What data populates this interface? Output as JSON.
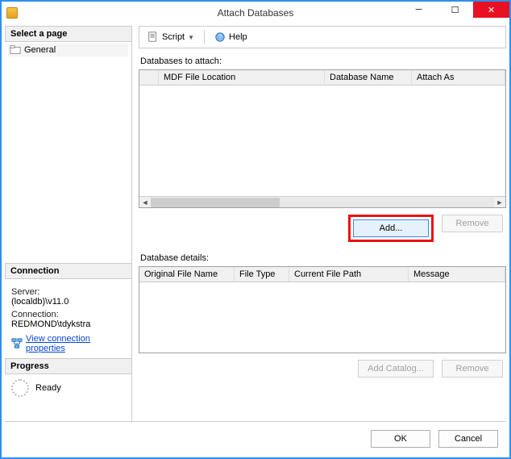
{
  "window": {
    "title": "Attach Databases",
    "minimize_glyph": "─",
    "maximize_glyph": "☐",
    "close_glyph": "✕"
  },
  "left": {
    "select_page_header": "Select a page",
    "pages": {
      "general": "General"
    },
    "connection_header": "Connection",
    "server_label": "Server:",
    "server_value": "(localdb)\\v11.0",
    "connection_label": "Connection:",
    "connection_value": "REDMOND\\tdykstra",
    "view_conn_props": "View connection properties",
    "progress_header": "Progress",
    "progress_label": "Ready"
  },
  "toolbar": {
    "script_label": "Script",
    "help_label": "Help"
  },
  "attach": {
    "label": "Databases to attach:",
    "cols": {
      "mdf": "MDF File Location",
      "dbname": "Database Name",
      "attachas": "Attach As"
    },
    "add_label": "Add...",
    "remove_label": "Remove"
  },
  "details": {
    "label": "Database details:",
    "cols": {
      "orig": "Original File Name",
      "ftype": "File Type",
      "path": "Current File Path",
      "msg": "Message"
    },
    "add_catalog_label": "Add Catalog...",
    "remove_label": "Remove"
  },
  "footer": {
    "ok": "OK",
    "cancel": "Cancel"
  }
}
